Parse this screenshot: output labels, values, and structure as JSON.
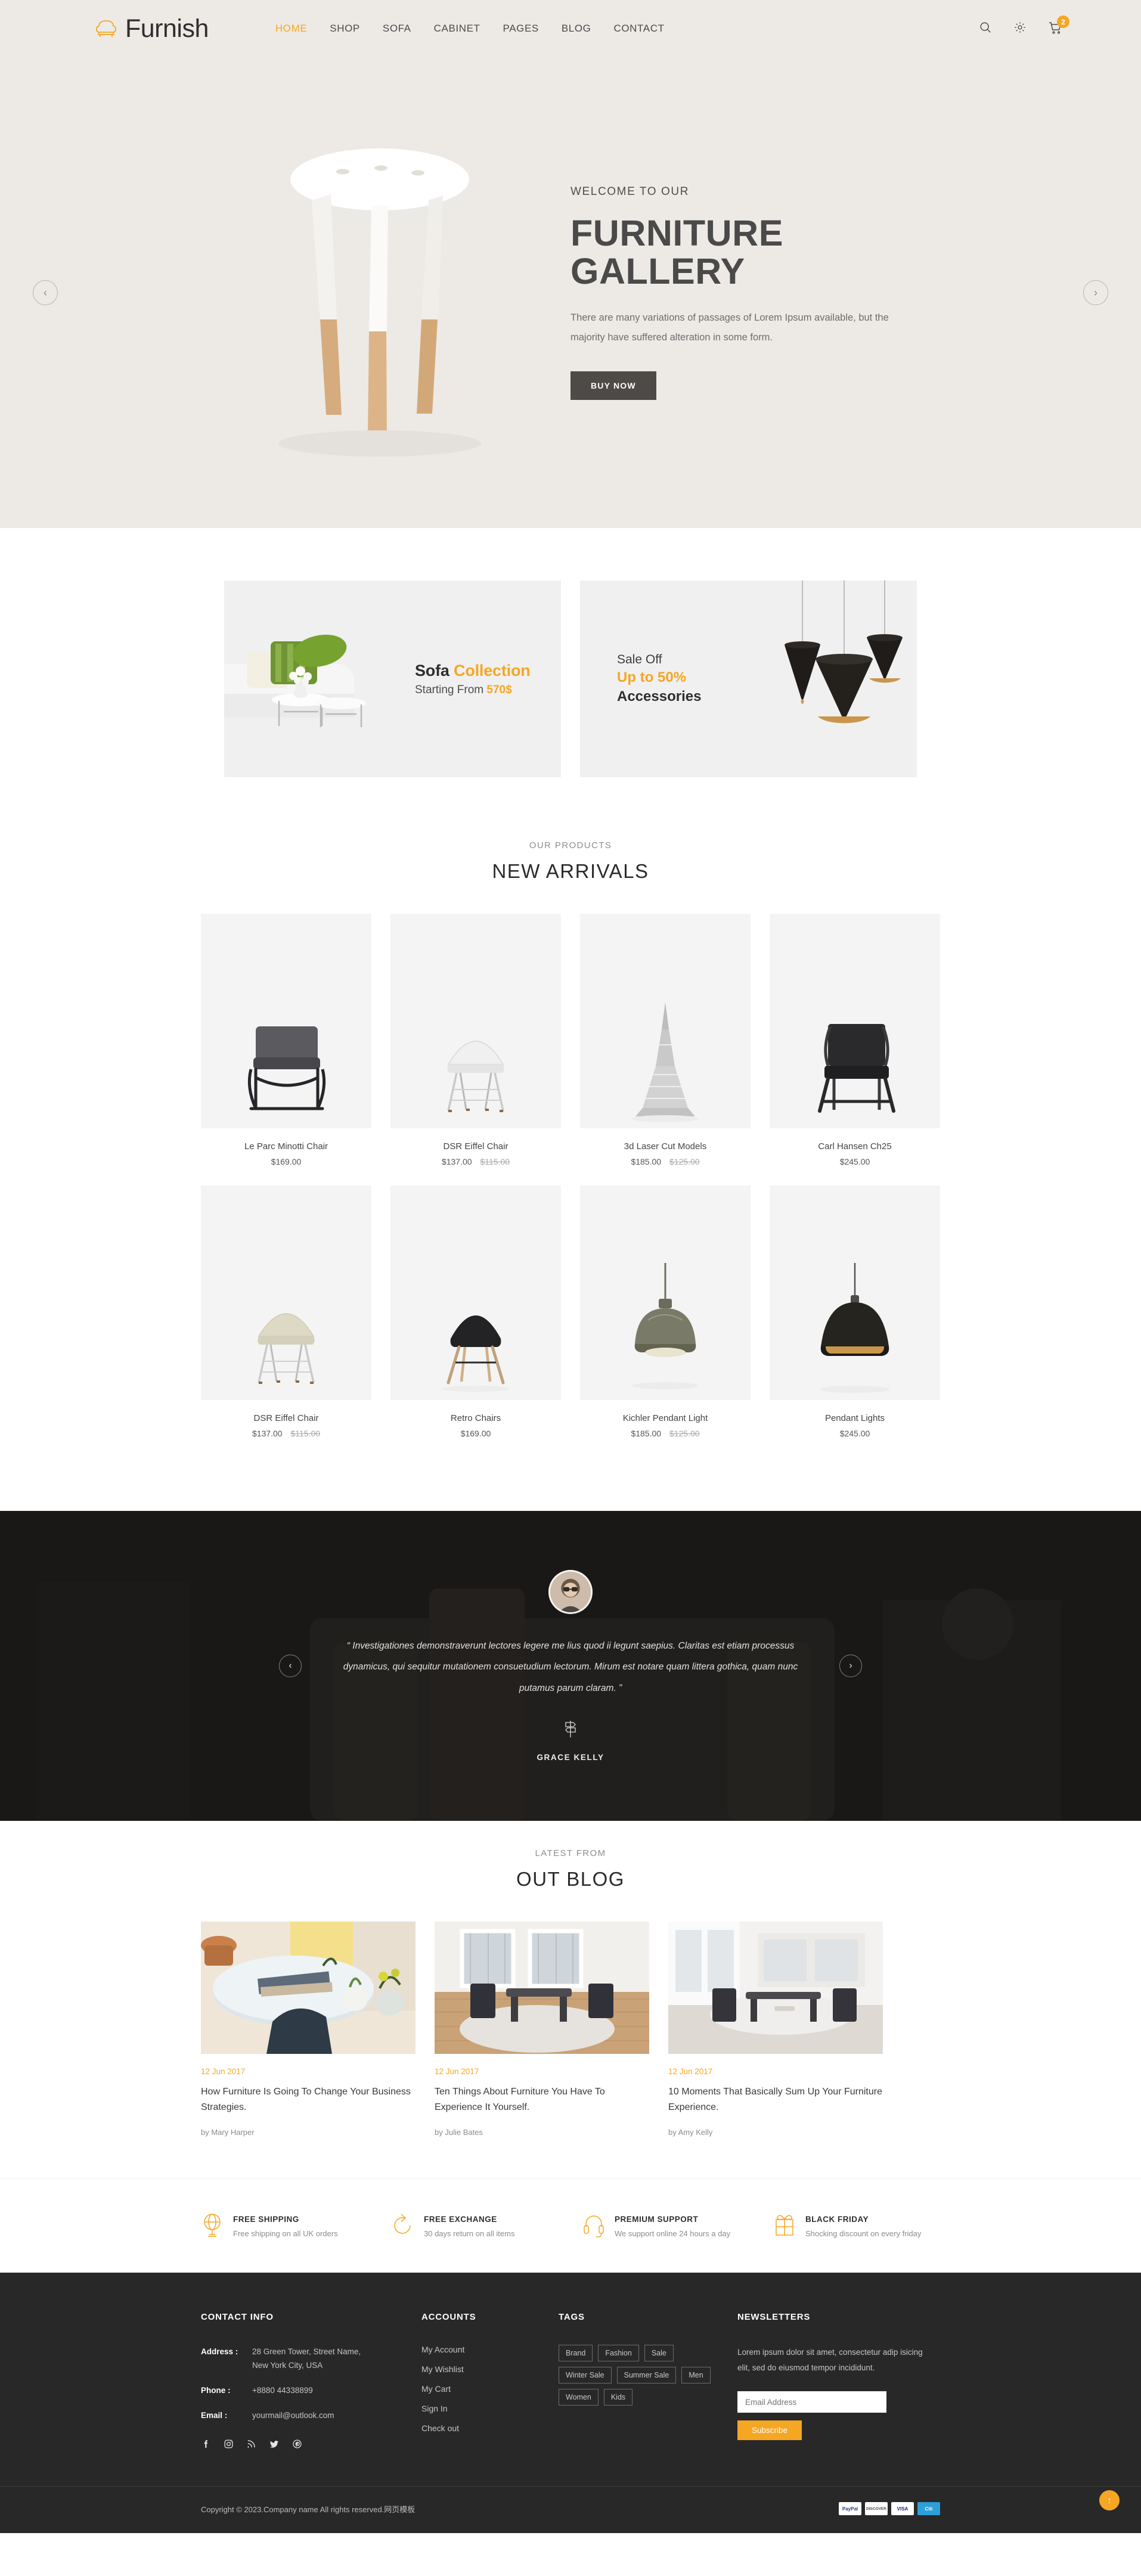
{
  "header": {
    "logo_text": "Furnish",
    "nav": [
      {
        "label": "HOME",
        "active": true
      },
      {
        "label": "SHOP",
        "active": false
      },
      {
        "label": "SOFA",
        "active": false
      },
      {
        "label": "CABINET",
        "active": false
      },
      {
        "label": "PAGES",
        "active": false
      },
      {
        "label": "BLOG",
        "active": false
      },
      {
        "label": "CONTACT",
        "active": false
      }
    ],
    "cart_count": "2"
  },
  "hero": {
    "welcome": "WELCOME TO OUR",
    "title": "FURNITURE GALLERY",
    "description": "There are many variations of passages of Lorem Ipsum available, but the majority have suffered alteration in some form.",
    "button": "BUY NOW",
    "prev": "‹",
    "next": "›"
  },
  "promos": {
    "sofa": {
      "title_dark": "Sofa",
      "title_accent": "Collection",
      "sub_text": "Starting From",
      "sub_price": "570$"
    },
    "sale": {
      "line1": "Sale Off",
      "line2": "Up to 50%",
      "line3": "Accessories"
    }
  },
  "products_section": {
    "kicker": "OUR PRODUCTS",
    "title": "NEW ARRIVALS",
    "rows": [
      [
        {
          "name": "Le Parc Minotti Chair",
          "price": "$169.00",
          "old_price": ""
        },
        {
          "name": "DSR Eiffel Chair",
          "price": "$137.00",
          "old_price": "$115.00"
        },
        {
          "name": "3d Laser Cut Models",
          "price": "$185.00",
          "old_price": "$125.00"
        },
        {
          "name": "Carl Hansen Ch25",
          "price": "$245.00",
          "old_price": ""
        }
      ],
      [
        {
          "name": "DSR Eiffel Chair",
          "price": "$137.00",
          "old_price": "$115.00"
        },
        {
          "name": "Retro Chairs",
          "price": "$169.00",
          "old_price": ""
        },
        {
          "name": "Kichler Pendant Light",
          "price": "$185.00",
          "old_price": "$125.00"
        },
        {
          "name": "Pendant Lights",
          "price": "$245.00",
          "old_price": ""
        }
      ]
    ]
  },
  "testimonial": {
    "quote": "“ Investigationes demonstraverunt lectores legere me lius quod ii legunt saepius. Claritas est etiam processus dynamicus, qui sequitur mutationem consuetudium lectorum. Mirum est notare quam littera gothica, quam nunc putamus parum claram. ”",
    "name": "GRACE KELLY",
    "prev": "‹",
    "next": "›"
  },
  "blog_section": {
    "kicker": "LATEST FROM",
    "title": "OUT BLOG",
    "posts": [
      {
        "date": "12 Jun 2017",
        "title": "How Furniture Is Going To Change Your Business Strategies.",
        "author": "by Mary Harper"
      },
      {
        "date": "12 Jun 2017",
        "title": "Ten Things About Furniture You Have To Experience It Yourself.",
        "author": "by Julie Bates"
      },
      {
        "date": "12 Jun 2017",
        "title": "10 Moments That Basically Sum Up Your Furniture Experience.",
        "author": "by Amy Kelly"
      }
    ]
  },
  "features": [
    {
      "icon": "globe-icon",
      "title": "FREE SHIPPING",
      "desc": "Free shipping on all UK orders"
    },
    {
      "icon": "exchange-icon",
      "title": "FREE EXCHANGE",
      "desc": "30 days return on all items"
    },
    {
      "icon": "headset-icon",
      "title": "PREMIUM SUPPORT",
      "desc": "We support online 24 hours a day"
    },
    {
      "icon": "gift-icon",
      "title": "BLACK FRIDAY",
      "desc": "Shocking discount on every friday"
    }
  ],
  "footer": {
    "contact": {
      "heading": "CONTACT INFO",
      "address_label": "Address :",
      "address_line1": "28 Green Tower, Street Name,",
      "address_line2": "New York City, USA",
      "phone_label": "Phone :",
      "phone_value": "+8880 44338899",
      "email_label": "Email :",
      "email_value": "yourmail@outlook.com",
      "socials": [
        "facebook-icon",
        "instagram-icon",
        "rss-icon",
        "twitter-icon",
        "pinterest-icon"
      ]
    },
    "accounts": {
      "heading": "ACCOUNTS",
      "links": [
        "My Account",
        "My Wishlist",
        "My Cart",
        "Sign In",
        "Check out"
      ]
    },
    "tags": {
      "heading": "TAGS",
      "items": [
        "Brand",
        "Fashion",
        "Sale",
        "Winter Sale",
        "Summer Sale",
        "Men",
        "Women",
        "Kids"
      ]
    },
    "newsletters": {
      "heading": "NEWSLETTERS",
      "desc": "Lorem ipsum dolor sit amet, consectetur adip isicing elit, sed do eiusmod tempor incididunt.",
      "placeholder": "Email Address",
      "button": "Subscribe"
    },
    "copyright": "Copyright © 2023.Company name All rights reserved.网页模板",
    "payments": [
      "PayPal",
      "DISCOVER",
      "VISA",
      "Citi"
    ],
    "to_top": "↑"
  },
  "colors": {
    "accent": "#f5a623",
    "hero_bg": "#edeae6",
    "footer_bg": "#282828",
    "dark_text": "#2e2e2e"
  }
}
